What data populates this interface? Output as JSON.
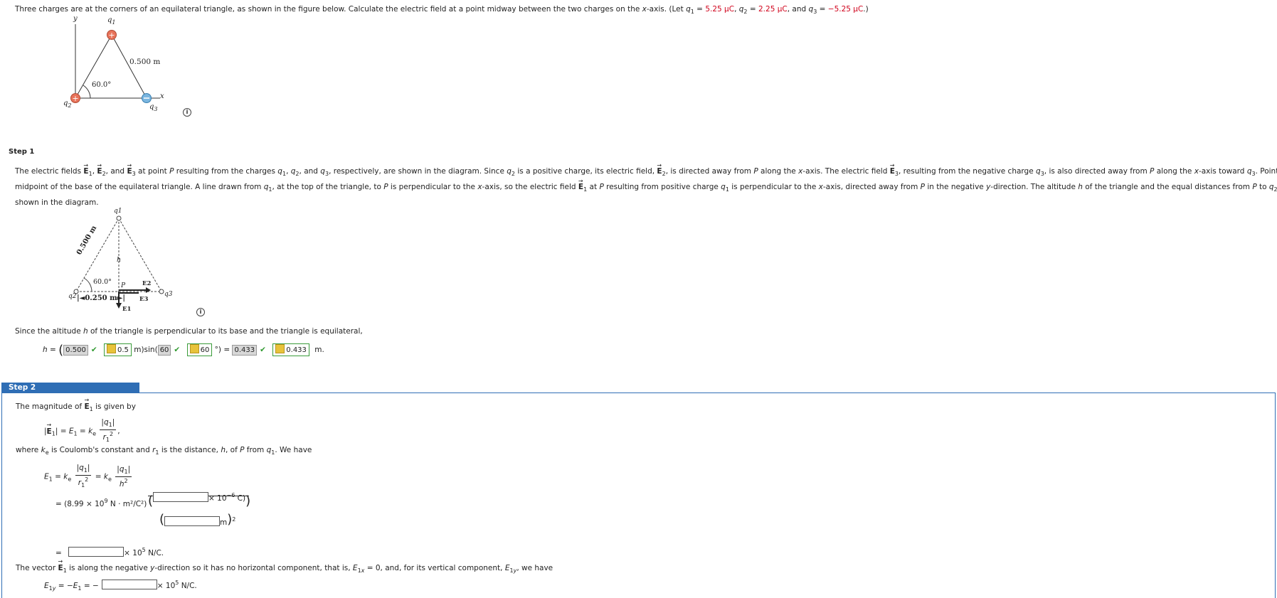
{
  "problem": {
    "text_main": "Three charges are at the corners of an equilateral triangle, as shown in the figure below. Calculate the electric field at a point midway between the two charges on the x-axis. (Let q",
    "q1_value": "5.25 μC",
    "q2_value": "2.25 μC",
    "q3_value": "−5.25 μC"
  },
  "figure1": {
    "label_y": "y",
    "label_x": "x",
    "label_q1": "q",
    "label_side": "0.500 m",
    "label_angle": "60.0°",
    "label_q2": "q",
    "label_q3": "q"
  },
  "step1": {
    "title": "Step 1",
    "explanation_line1": "The electric fields E1, E2, and E3 at point P resulting from the charges q1, q2, and q3, respectively, are shown in the diagram. Since q2 is a positive charge, its electric field, E2, is directed away from P along the x-axis. The electric field E3, resulting from the negative charge q3, is also directed away from P along the x-axis toward q3. Point P is the",
    "explanation_line2": "midpoint of the base of the equilateral triangle. A line drawn from q1, at the top of the triangle, to P is perpendicular to the x-axis, so the electric field E1 at P resulting from positive charge q1 is perpendicular to the x-axis, directed away from P in the negative y-direction. The altitude h of the triangle and the equal distances from P to q2 and P to q3 are",
    "explanation_line3": "shown in the diagram.",
    "fig_label_q1": "q1",
    "fig_label_side": "0.500 m",
    "fig_label_h": "h",
    "fig_label_angle": "60.0°",
    "fig_label_P": "P",
    "fig_label_E2": "E2",
    "fig_label_E3": "E3",
    "fig_label_E1": "E1",
    "fig_label_q2": "q2",
    "fig_label_q3": "q3",
    "fig_label_base": "0.250 m",
    "altitude_intro": "Since the altitude h of the triangle is perpendicular to its base and the triangle is equilateral,",
    "h_label": "h =",
    "ans_side": "0.500",
    "ans_side_key": "0.5",
    "unit_m_sin": "m)sin(",
    "ans_angle": "60",
    "ans_angle_key": "60",
    "deg_eq": "°) =",
    "ans_h": "0.433",
    "ans_h_key": "0.433",
    "unit_m": "m."
  },
  "step2": {
    "title": "Step 2",
    "intro": "The magnitude of E1 is given by",
    "where_text": "where ke is Coulomb's constant and r1 is the distance, h, of P from q1. We have",
    "coulomb_const": "= (8.99 × 10",
    "coulomb_exp": "9",
    "coulomb_units": " N · m²/C²)",
    "micro_unit": "× 10",
    "micro_exp": "−6",
    "micro_c": " C)",
    "m_unit": "m",
    "result_times": "× 10",
    "result_exp": "5",
    "result_unit": " N/C.",
    "vector_text": "The vector E1 is along the negative y-direction so it has no horizontal component, that is, E1x = 0, and, for its vertical component, E1y, we have",
    "e1y_result_times": "× 10",
    "e1y_result_exp": "5",
    "e1y_result_unit": " N/C."
  }
}
